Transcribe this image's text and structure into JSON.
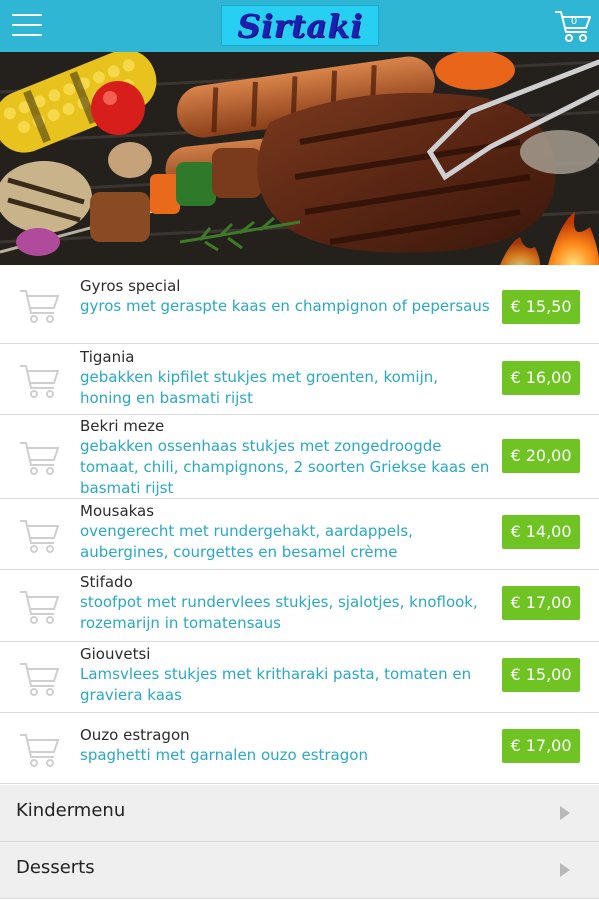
{
  "header": {
    "logo_text": "Sirtaki",
    "cart_count": "0",
    "menu_icon": "hamburger-menu-icon",
    "cart_icon": "shopping-cart-icon"
  },
  "colors": {
    "header_bg": "#2fb6d4",
    "logo_bg": "#27d0f2",
    "logo_text": "#1c1fb0",
    "description": "#2aa8c4",
    "price_button": "#6fc424",
    "category_bg": "#efefef"
  },
  "dishes": [
    {
      "name": "Gyros special",
      "description": "gyros met geraspte kaas en champignon of pepersaus",
      "price": "€ 15,50"
    },
    {
      "name": "Tigania",
      "description": "gebakken kipfilet stukjes met groenten, komijn, honing en basmati rijst",
      "price": "€ 16,00"
    },
    {
      "name": "Bekri meze",
      "description": "gebakken ossenhaas stukjes met zongedroogde tomaat, chili, champignons, 2 soorten Griekse kaas en basmati rijst",
      "price": "€ 20,00"
    },
    {
      "name": "Mousakas",
      "description": "ovengerecht met rundergehakt, aardappels, aubergines, courgettes en besamel crème",
      "price": "€ 14,00"
    },
    {
      "name": "Stifado",
      "description": "stoofpot met rundervlees stukjes, sjalotjes, knoflook, rozemarijn in tomatensaus",
      "price": "€ 17,00"
    },
    {
      "name": "Giouvetsi",
      "description": "Lamsvlees stukjes met kritharaki pasta, tomaten en graviera kaas",
      "price": "€ 15,00"
    },
    {
      "name": "Ouzo estragon",
      "description": "spaghetti met garnalen ouzo estragon",
      "price": "€ 17,00"
    }
  ],
  "categories": [
    {
      "label": "Kindermenu"
    },
    {
      "label": "Desserts"
    }
  ]
}
